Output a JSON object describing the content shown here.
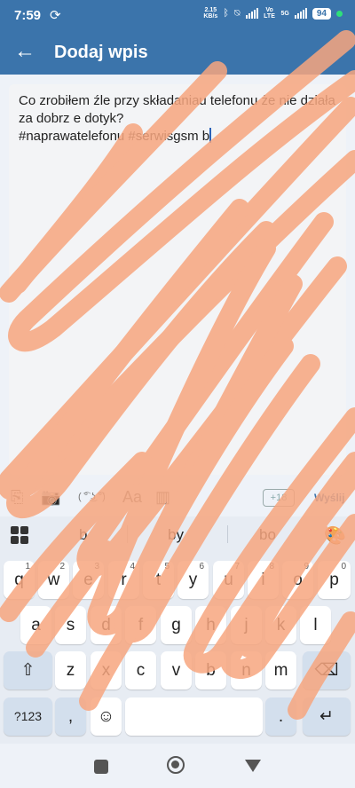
{
  "status": {
    "time": "7:59",
    "sync_icon": "sync-icon",
    "data_speed": "2.15",
    "data_unit": "KB/s",
    "net_label_1": "Vo LTE",
    "net_label_2": "5G",
    "battery": "94",
    "accent": "#3b74ab"
  },
  "appbar": {
    "back_icon": "arrow-left-icon",
    "title": "Dodaj wpis"
  },
  "editor": {
    "text": "Co zrobiłem źle przy składaniau telefonu że nie działa\nza dobrz e dotyk?\n#naprawatelefonu #serwisgsm b"
  },
  "toolbar": {
    "count": "+18",
    "send": "Wyślij",
    "icons": [
      "attachment-icon",
      "camera-icon",
      "lenny-face-icon",
      "text-format-icon",
      "poll-icon"
    ],
    "format_label": "Aa",
    "lenny_label": "( ͡° ͜ʖ ͡°)"
  },
  "keyboard": {
    "suggestions": [
      "b",
      "by",
      "bo"
    ],
    "row1": [
      "q",
      "w",
      "e",
      "r",
      "t",
      "y",
      "u",
      "i",
      "o",
      "p"
    ],
    "row1_nums": [
      "1",
      "2",
      "3",
      "4",
      "5",
      "6",
      "7",
      "8",
      "9",
      "0"
    ],
    "row2": [
      "a",
      "s",
      "d",
      "f",
      "g",
      "h",
      "j",
      "k",
      "l"
    ],
    "row3": [
      "z",
      "x",
      "c",
      "v",
      "b",
      "n",
      "m"
    ],
    "sym_label": "?123",
    "comma": ",",
    "period": ".",
    "emoji_icon": "emoji-icon",
    "shift_icon": "shift-icon",
    "backspace_icon": "backspace-icon",
    "enter_icon": "enter-icon",
    "apps_icon": "apps-grid-icon",
    "palette_icon": "palette-icon"
  },
  "overlay_color": "#f7a67f"
}
